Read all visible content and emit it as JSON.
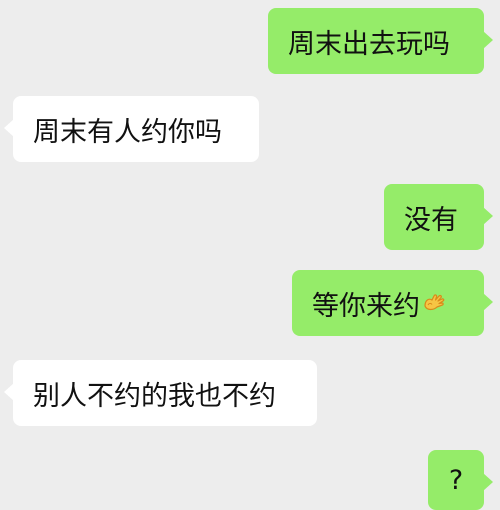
{
  "messages": [
    {
      "side": "out",
      "text": "周末出去玩吗"
    },
    {
      "side": "in",
      "text": "周末有人约你吗"
    },
    {
      "side": "out",
      "text": "没有"
    },
    {
      "side": "out",
      "text": "等你来约",
      "emoji": "wave-hand-emoji"
    },
    {
      "side": "in",
      "text": "别人不约的我也不约"
    },
    {
      "side": "out",
      "text": "?"
    }
  ],
  "colors": {
    "background": "#ededed",
    "outgoing_bubble": "#95ec69",
    "incoming_bubble": "#ffffff",
    "text": "#111111"
  }
}
